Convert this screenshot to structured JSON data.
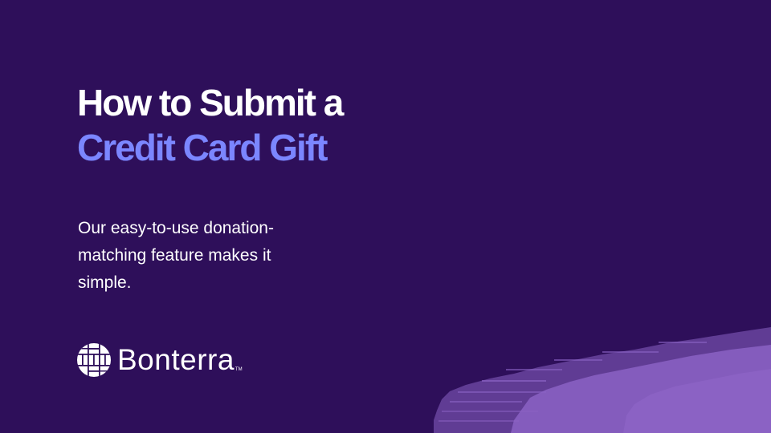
{
  "slide": {
    "title_line1": "How to Submit a",
    "title_line2": "Credit Card  Gift",
    "subtitle": "Our easy-to-use donation-matching feature makes it simple.",
    "brand": {
      "name": "Bonterra",
      "trademark": "TM",
      "logo_icon": "woven-circle-icon"
    }
  },
  "colors": {
    "background": "#2e0f5a",
    "title": "#ffffff",
    "accent": "#7b86ff",
    "brush": "#8b62c4"
  }
}
